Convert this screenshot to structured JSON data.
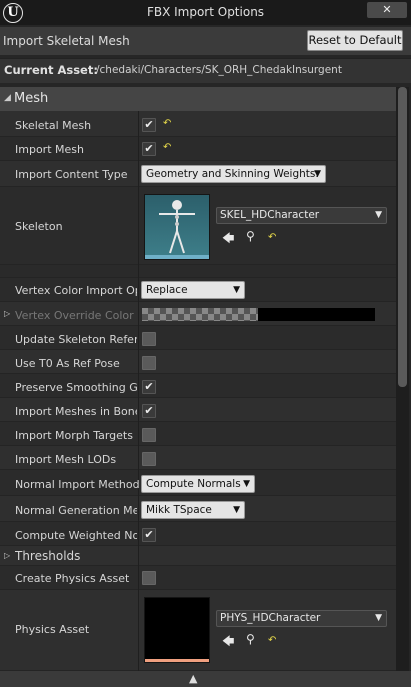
{
  "window": {
    "title": "FBX Import Options",
    "logo": "U",
    "close_label": "✕"
  },
  "header": {
    "title": "Import Skeletal Mesh",
    "reset_label": "Reset to Default"
  },
  "current_asset": {
    "label": "Current Asset:",
    "path": "/chedaki/Characters/SK_ORH_ChedakInsurgent"
  },
  "section": {
    "label": "Mesh"
  },
  "props": {
    "skeletal_mesh": "Skeletal Mesh",
    "import_mesh": "Import Mesh",
    "import_content_type": "Import Content Type",
    "import_content_type_value": "Geometry and Skinning Weights.",
    "skeleton": "Skeleton",
    "skeleton_value": "SKEL_HDCharacter",
    "vertex_color_import": "Vertex Color Import Opti",
    "vertex_color_import_value": "Replace",
    "vertex_override_color": "Vertex Override Color",
    "update_skeleton": "Update Skeleton Referer",
    "use_t0": "Use T0 As Ref Pose",
    "preserve_smoothing": "Preserve Smoothing Gro",
    "import_meshes_bone": "Import Meshes in Bone H",
    "import_morph": "Import Morph Targets",
    "import_lods": "Import Mesh LODs",
    "normal_import_method": "Normal Import Method",
    "normal_import_method_value": "Compute Normals",
    "normal_generation": "Normal Generation Meth",
    "normal_generation_value": "Mikk TSpace",
    "compute_weighted": "Compute Weighted Norm",
    "thresholds": "Thresholds",
    "create_physics": "Create Physics Asset",
    "physics_asset": "Physics Asset",
    "physics_asset_value": "PHYS_HDCharacter"
  },
  "icons": {
    "check": "✔",
    "reset": "↶",
    "back": "🡄",
    "search": "⚲",
    "dropdown": "▼",
    "expand": "▷",
    "collapse": "◢",
    "scroll_up": "▲"
  }
}
